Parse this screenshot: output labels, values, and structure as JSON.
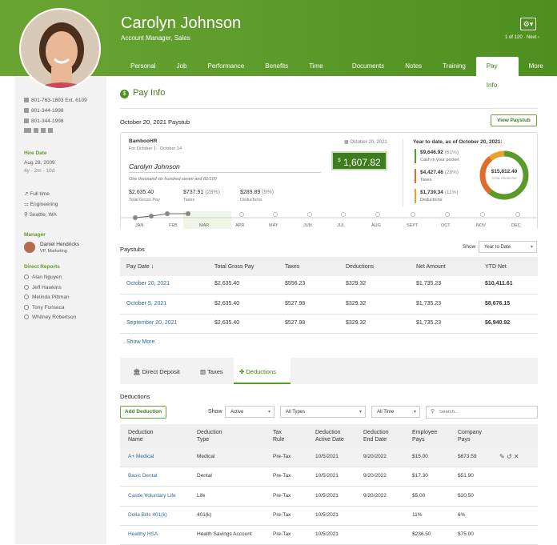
{
  "employee": {
    "name": "Carolyn Johnson",
    "role": "Account Manager, Sales",
    "pager": "1 of 120 · Next ›"
  },
  "tabs": [
    "Personal",
    "Job",
    "Performance",
    "Benefits",
    "Time Off",
    "Documents",
    "Notes",
    "Training",
    "Pay Info",
    "More ▾"
  ],
  "sidebar": {
    "work_phone": "801-763-1893  Ext. 6109",
    "mobile": "801-344-1998",
    "home": "801-344-1998",
    "hire_label": "Hire Date",
    "hire_date": "Aug 28, 2009",
    "tenure": "4y - 2m - 10d",
    "status": "Full time",
    "dept": "Engineering",
    "location": "Seattle, WA",
    "manager_label": "Manager",
    "manager": "Daniel Hendricks",
    "manager_title": "VP, Marketing",
    "reports_label": "Direct Reports",
    "reports": [
      "Alan Nguyen",
      "Jeff Hawkins",
      "Melinda Pittman",
      "Tony Fonseca",
      "Whitney Robertson"
    ]
  },
  "page": {
    "title": "Pay Info",
    "paystub_date": "October 20, 2021 Paystub",
    "view_btn": "View Paystub"
  },
  "stub": {
    "company": "BambooHR",
    "period": "For October 1 - October 14",
    "date": "October 20, 2021",
    "net": "1,607.82",
    "net_sym": "$",
    "payee": "Carolyn Johnson",
    "words": "One thousand six hundred seven and 82/100",
    "gross": "$2,635.40",
    "gross_label": "Total Gross Pay",
    "taxes": "$737.91",
    "taxes_pct": "(28%)",
    "taxes_label": "Taxes",
    "ded": "$289.89",
    "ded_pct": "(9%)",
    "ded_label": "Deductions",
    "ytd_title": "Year to date, as of October 20, 2021:",
    "ytd_cash": "$9,646.92",
    "ytd_cash_pct": "(61%)",
    "ytd_cash_label": "Cash in your pocket",
    "ytd_tax": "$4,427.46",
    "ytd_tax_pct": "(28%)",
    "ytd_tax_label": "Taxes",
    "ytd_ded": "$1,739.34",
    "ytd_ded_pct": "(11%)",
    "ytd_ded_label": "Deductions",
    "ytd_total": "$15,812.40",
    "ytd_total_label": "TOTAL GROSS PAY",
    "months": [
      "JAN",
      "FEB",
      "MAR",
      "APR",
      "MAY",
      "JUN",
      "JUL",
      "AUG",
      "SEPT",
      "OCT",
      "NOV",
      "DEC"
    ]
  },
  "paystubs": {
    "title": "Paystubs",
    "show": "Show",
    "range": "Year to Date",
    "headers": [
      "Pay Date ↓",
      "Total Gross Pay",
      "Taxes",
      "Deductions",
      "Net Amount",
      "YTD Net"
    ],
    "rows": [
      [
        "October 20, 2021",
        "$2,635.40",
        "$556.23",
        "$329.32",
        "$1,735.23",
        "$10,411.61"
      ],
      [
        "October 5, 2021",
        "$2,635.40",
        "$527.98",
        "$329.32",
        "$1,735.23",
        "$8,676.15"
      ],
      [
        "September 20, 2021",
        "$2,635.40",
        "$527.98",
        "$329.32",
        "$1,735.23",
        "$6,940.92"
      ]
    ],
    "more": "Show More"
  },
  "subtabs": [
    "Direct Deposit",
    "Taxes",
    "Deductions"
  ],
  "deductions": {
    "title": "Deductions",
    "add": "Add Deduction",
    "show": "Show",
    "filter1": "Active",
    "filter2": "All Types",
    "filter3": "All Time",
    "search_ph": "Search...",
    "headers": [
      [
        "Deduction",
        "Name"
      ],
      [
        "Deduction",
        "Type"
      ],
      [
        "Tax",
        "Rule"
      ],
      [
        "Deduction",
        "Active Date"
      ],
      [
        "Deduction",
        "End Date"
      ],
      [
        "Employee",
        "Pays"
      ],
      [
        "Company",
        "Pays"
      ]
    ],
    "rows": [
      [
        "A+ Medical",
        "Medical",
        "Pre-Tax",
        "10/5/2021",
        "9/20/2022",
        "$15.00",
        "$673.59"
      ],
      [
        "Basic Dental",
        "Dental",
        "Pre-Tax",
        "10/5/2021",
        "9/20/2022",
        "$17.30",
        "$51.90"
      ],
      [
        "Castle Voluntary Life",
        "Life",
        "Pre-Tax",
        "10/5/2021",
        "9/20/2022",
        "$5.00",
        "$20.50"
      ],
      [
        "Dolla Bills 401(k)",
        "401(k)",
        "Pre-Tax",
        "10/5/2021",
        "",
        "11%",
        "6%"
      ],
      [
        "Healthy HSA",
        "Health Savings Account",
        "Pre-Tax",
        "10/5/2021",
        "",
        "$236.50",
        "$75.00"
      ]
    ]
  },
  "colors": {
    "brand": "#5a9a2a",
    "cash": "#5a9a2a",
    "taxes": "#e06b2a",
    "deductions": "#e8a030"
  }
}
